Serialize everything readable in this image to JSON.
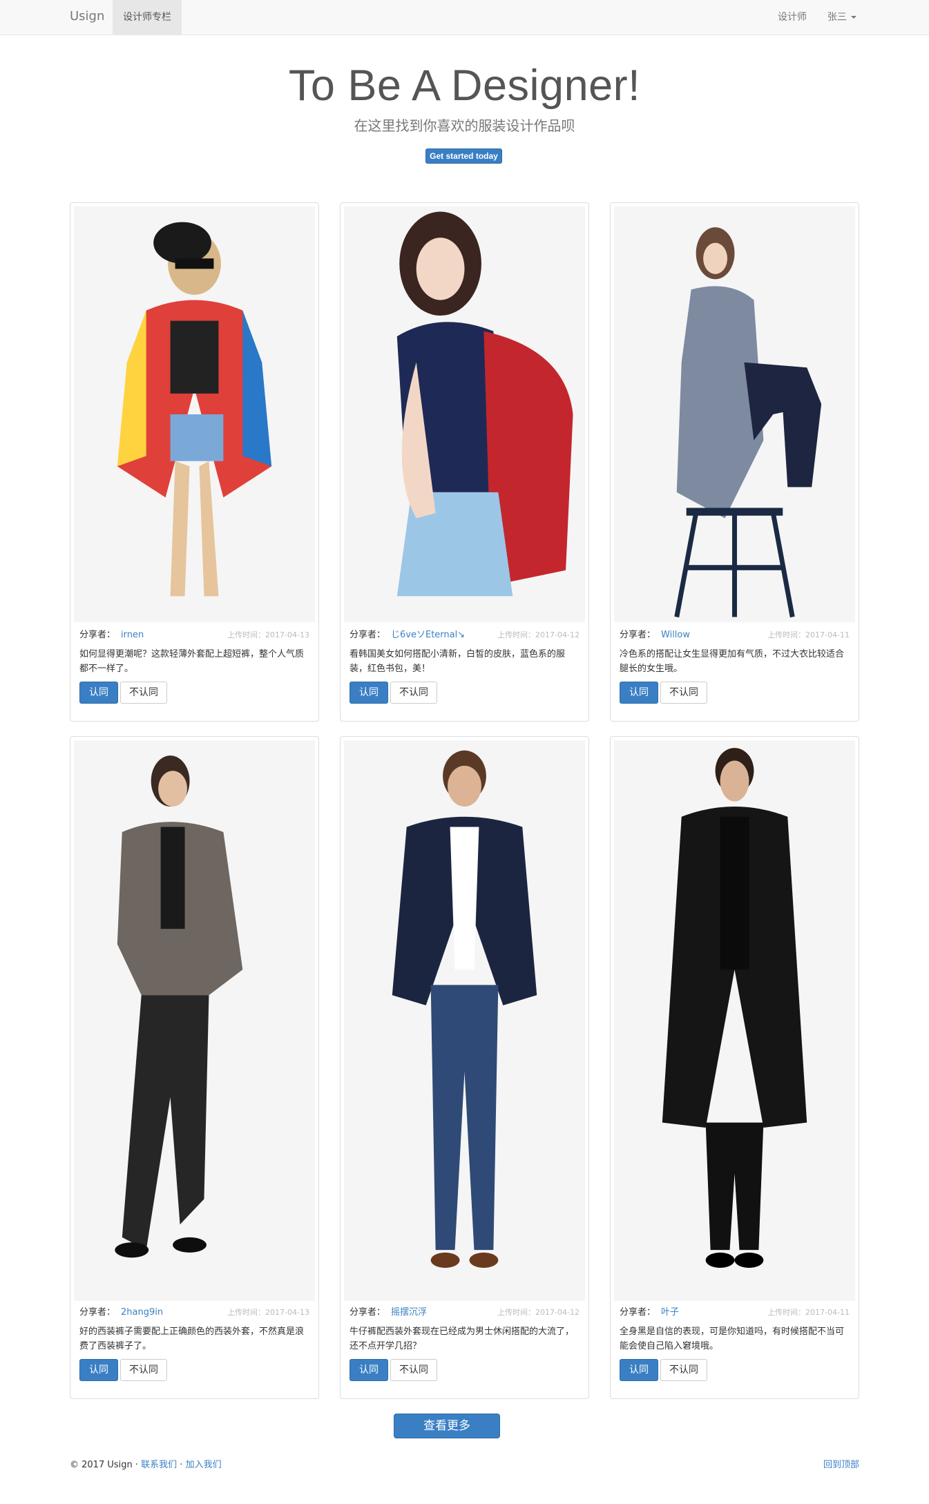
{
  "navbar": {
    "brand": "Usign",
    "active_item": "设计师专栏",
    "right_link": "设计师",
    "user_menu": "张三"
  },
  "hero": {
    "title": "To Be A Designer!",
    "subtitle": "在这里找到你喜欢的服装设计作品呗",
    "button": "Get started today"
  },
  "card_labels": {
    "sharer": "分享者：",
    "agree": "认同",
    "disagree": "不认同"
  },
  "cards": [
    {
      "user": "irnen",
      "time": "上传时间：2017-04-13",
      "desc": "如何显得更潮呢？这款轻薄外套配上超短裤，整个人气质都不一样了。",
      "image": "woman-printed-jacket-sunglasses"
    },
    {
      "user": "じ6veソEternal↘",
      "time": "上传时间：2017-04-12",
      "desc": "看韩国美女如何搭配小清新，白皙的皮肤，蓝色系的服装，红色书包，美！",
      "image": "girl-red-backpack"
    },
    {
      "user": "Willow",
      "time": "上传时间：2017-04-11",
      "desc": "冷色系的搭配让女生显得更加有气质，不过大衣比较适合腿长的女生哦。",
      "image": "woman-grey-coat-stool"
    },
    {
      "user": "2hang9in",
      "time": "上传时间：2017-04-13",
      "desc": "好的西装裤子需要配上正确颜色的西装外套，不然真是浪费了西装裤子了。",
      "image": "man-grey-blazer"
    },
    {
      "user": "摇摆沉浮",
      "time": "上传时间：2017-04-12",
      "desc": "牛仔裤配西装外套现在已经成为男士休闲搭配的大流了，还不点开学几招？",
      "image": "man-navy-blazer-jeans"
    },
    {
      "user": "叶子",
      "time": "上传时间：2017-04-11",
      "desc": "全身黑是自信的表现，可是你知道吗，有时候搭配不当可能会使自己陷入窘境哦。",
      "image": "man-black-coat"
    }
  ],
  "more_button": "查看更多",
  "footer": {
    "copyright": "© 2017 Usign · ",
    "contact": "联系我们",
    "join": "加入我们",
    "back_to_top": "回到顶部"
  },
  "colors": {
    "primary": "#3a7fc4",
    "navbar_bg": "#f8f8f8"
  }
}
